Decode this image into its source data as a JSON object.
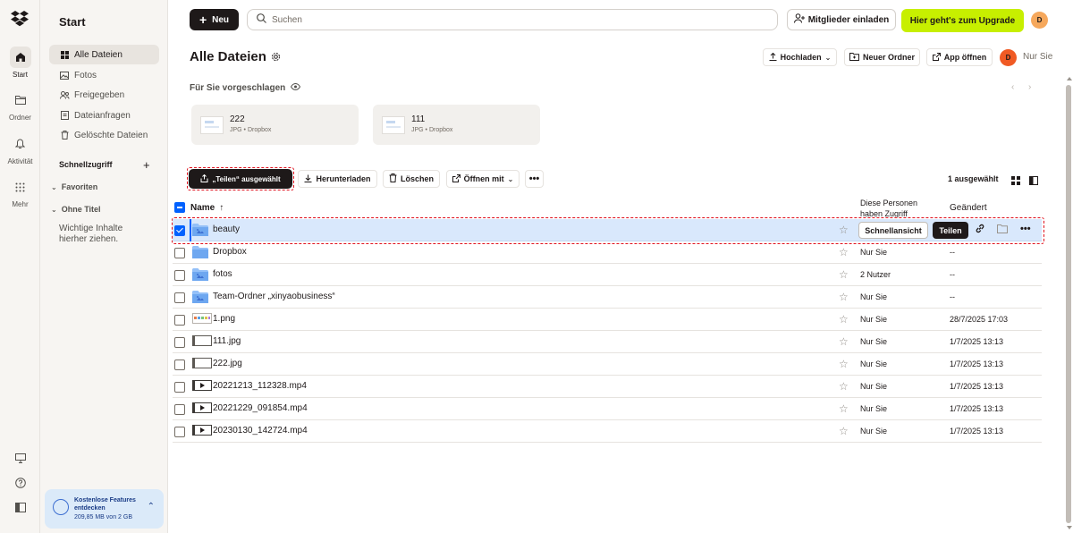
{
  "app": {
    "name": "Dropbox"
  },
  "rail": {
    "items": [
      {
        "label": "Start",
        "icon": "home-icon"
      },
      {
        "label": "Ordner",
        "icon": "folder-icon"
      },
      {
        "label": "Aktivität",
        "icon": "bell-icon"
      },
      {
        "label": "Mehr",
        "icon": "grid-icon"
      }
    ]
  },
  "sidebar": {
    "title": "Start",
    "items": [
      {
        "label": "Alle Dateien",
        "icon": "files-icon"
      },
      {
        "label": "Fotos",
        "icon": "photo-icon"
      },
      {
        "label": "Freigegeben",
        "icon": "shared-icon"
      },
      {
        "label": "Dateianfragen",
        "icon": "file-request-icon"
      },
      {
        "label": "Gelöschte Dateien",
        "icon": "trash-icon"
      }
    ],
    "quick_access": "Schnellzugriff",
    "favorites": "Favoriten",
    "untitled": "Ohne Titel",
    "empty_hint": "Wichtige Inhalte hierher ziehen.",
    "promo": {
      "title": "Kostenlose Features entdecken",
      "usage": "209,85 MB von 2 GB"
    }
  },
  "topbar": {
    "new_label": "Neu",
    "search_placeholder": "Suchen",
    "invite_label": "Mitglieder einladen",
    "upgrade_label": "Hier geht's zum Upgrade",
    "avatar_initial": "D"
  },
  "header": {
    "title": "Alle Dateien",
    "upload_label": "Hochladen",
    "new_folder_label": "Neuer Ordner",
    "open_app_label": "App öffnen",
    "owner_initial": "D",
    "owner_text": "Nur Sie"
  },
  "suggested": {
    "title": "Für Sie vorgeschlagen",
    "cards": [
      {
        "name": "222",
        "meta": "JPG • Dropbox"
      },
      {
        "name": "111",
        "meta": "JPG • Dropbox"
      }
    ]
  },
  "actions": {
    "share_selected": "„Teilen“ ausgewählt",
    "download": "Herunterladen",
    "delete": "Löschen",
    "open_with": "Öffnen mit",
    "selected_count": "1 ausgewählt"
  },
  "table": {
    "col_name": "Name",
    "col_access": "Diese Personen haben Zugriff",
    "col_changed": "Geändert",
    "selected_row_actions": {
      "quick_view": "Schnellansicht",
      "share": "Teilen"
    },
    "rows": [
      {
        "name": "beauty",
        "type": "photo-folder",
        "access": "",
        "changed": "",
        "selected": true
      },
      {
        "name": "Dropbox",
        "type": "folder",
        "access": "Nur Sie",
        "changed": "--"
      },
      {
        "name": "fotos",
        "type": "photo-folder",
        "access": "2 Nutzer",
        "changed": "--"
      },
      {
        "name": "Team-Ordner „xinyaobusiness“",
        "type": "photo-folder",
        "access": "Nur Sie",
        "changed": "--"
      },
      {
        "name": "1.png",
        "type": "image",
        "access": "Nur Sie",
        "changed": "28/7/2025 17:03"
      },
      {
        "name": "111.jpg",
        "type": "image-blank",
        "access": "Nur Sie",
        "changed": "1/7/2025 13:13"
      },
      {
        "name": "222.jpg",
        "type": "image-blank",
        "access": "Nur Sie",
        "changed": "1/7/2025 13:13"
      },
      {
        "name": "20221213_112328.mp4",
        "type": "video",
        "access": "Nur Sie",
        "changed": "1/7/2025 13:13"
      },
      {
        "name": "20221229_091854.mp4",
        "type": "video",
        "access": "Nur Sie",
        "changed": "1/7/2025 13:13"
      },
      {
        "name": "20230130_142724.mp4",
        "type": "video",
        "access": "Nur Sie",
        "changed": "1/7/2025 13:13"
      }
    ]
  },
  "colors": {
    "accent": "#0061fe",
    "upgrade": "#c7ef00",
    "highlight": "#e0101c"
  }
}
